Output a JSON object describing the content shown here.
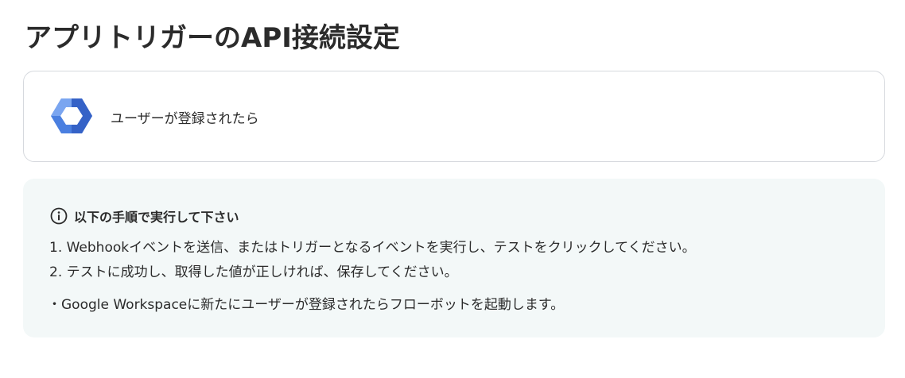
{
  "page": {
    "title": "アプリトリガーのAPI接続設定"
  },
  "trigger": {
    "app_icon": "google-workspace-icon",
    "label": "ユーザーが登録されたら"
  },
  "instructions": {
    "icon": "info-icon",
    "heading": "以下の手順で実行して下さい",
    "steps": [
      "1. Webhookイベントを送信、またはトリガーとなるイベントを実行し、テストをクリックしてください。",
      "2. テストに成功し、取得した値が正しければ、保存してください。"
    ],
    "note": "・Google Workspaceに新たにユーザーが登録されたらフローボットを起動します。"
  },
  "colors": {
    "text": "#2b2b2b",
    "card_border": "#d6d9de",
    "panel_background": "#f3f8f8",
    "icon_blue_dark": "#3b6fd8",
    "icon_blue_light": "#7ba6f0"
  }
}
